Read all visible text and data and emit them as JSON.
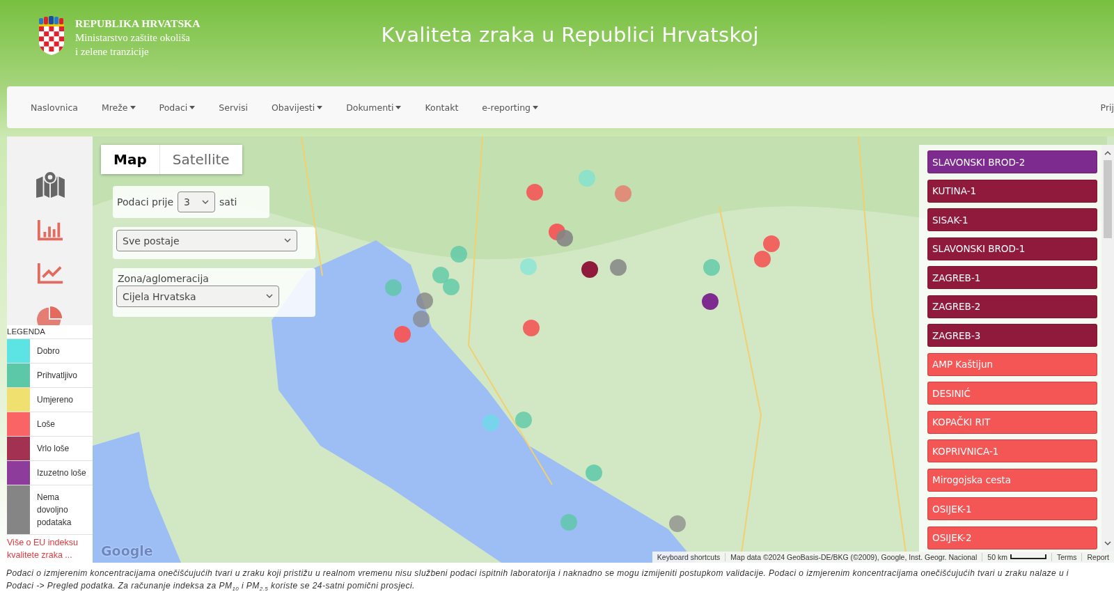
{
  "header": {
    "emblem_lines": [
      "REPUBLIKA HRVATSKA",
      "Ministarstvo zaštite okoliša",
      "i zelene tranzicije"
    ],
    "title": "Kvaliteta zraka u Republici Hrvatskoj"
  },
  "nav": {
    "items": [
      {
        "label": "Naslovnica",
        "dropdown": false
      },
      {
        "label": "Mreže",
        "dropdown": true
      },
      {
        "label": "Podaci",
        "dropdown": true
      },
      {
        "label": "Servisi",
        "dropdown": false
      },
      {
        "label": "Obavijesti",
        "dropdown": true
      },
      {
        "label": "Dokumenti",
        "dropdown": true
      },
      {
        "label": "Kontakt",
        "dropdown": false
      },
      {
        "label": "e-reporting",
        "dropdown": true
      }
    ],
    "login": "Prij"
  },
  "sidebar": {
    "tools": [
      {
        "kind": "map",
        "selected": true
      },
      {
        "kind": "bar",
        "selected": false
      },
      {
        "kind": "line",
        "selected": false
      },
      {
        "kind": "pie",
        "selected": false
      }
    ],
    "legend": {
      "title": "LEGENDA",
      "items": [
        {
          "label": "Dobro",
          "color": "#5ce4e4"
        },
        {
          "label": "Prihvatljivo",
          "color": "#5cc8a8"
        },
        {
          "label": "Umjereno",
          "color": "#f0e070"
        },
        {
          "label": "Loše",
          "color": "#fa6464"
        },
        {
          "label": "Vrlo loše",
          "color": "#a33252"
        },
        {
          "label": "Izuzetno loše",
          "color": "#8e3c9c"
        },
        {
          "label": "Nema dovoljno podataka",
          "color": "#858585"
        }
      ],
      "link": "Više o EU indeksu kvalitete zraka ..."
    }
  },
  "map": {
    "type_tabs": [
      {
        "label": "Map",
        "selected": true
      },
      {
        "label": "Satellite",
        "selected": false
      }
    ],
    "hours": {
      "prefix": "Podaci prije",
      "value": "3",
      "suffix": "sati"
    },
    "station_select": {
      "value": "Sve postaje"
    },
    "zone": {
      "label": "Zona/aglomeracija",
      "value": "Cijela Hrvatska"
    },
    "stations": [
      {
        "name": "SLAVONSKI BROD-2",
        "color": "#7e2b8f"
      },
      {
        "name": "KUTINA-1",
        "color": "#8f1a3c"
      },
      {
        "name": "SISAK-1",
        "color": "#8f1a3c"
      },
      {
        "name": "SLAVONSKI BROD-1",
        "color": "#8f1a3c"
      },
      {
        "name": "ZAGREB-1",
        "color": "#8f1a3c"
      },
      {
        "name": "ZAGREB-2",
        "color": "#8f1a3c"
      },
      {
        "name": "ZAGREB-3",
        "color": "#8f1a3c"
      },
      {
        "name": "AMP Kaštijun",
        "color": "#f45656"
      },
      {
        "name": "DESINIĆ",
        "color": "#f45656"
      },
      {
        "name": "KOPAČKI RIT",
        "color": "#f45656"
      },
      {
        "name": "KOPRIVNICA-1",
        "color": "#f45656"
      },
      {
        "name": "Mirogojska cesta",
        "color": "#f45656"
      },
      {
        "name": "OSIJEK-1",
        "color": "#f45656"
      },
      {
        "name": "OSIJEK-2",
        "color": "#f45656"
      }
    ],
    "logo": "Google",
    "attribution": {
      "shortcuts": "Keyboard shortcuts",
      "data": "Map data ©2024 GeoBasis-DE/BKG (©2009), Google, Inst. Geogr. Nacional",
      "scale": "50 km",
      "terms": "Terms",
      "report": "Report"
    }
  },
  "footer": {
    "lines": [
      "Podaci o izmjerenim koncentracijama onečišćujućih tvari u zraku koji pristižu u realnom vremenu nisu službeni podaci ispitnih laboratorija i naknadno se mogu izmijeniti postupkom validacije. Podaci o izmjerenim koncentracijama onečišćujućih tvari u zraku nalaze u i",
      "Podaci -> Pregled podatka. Za računanje indeksa za PM$_{10}$ i PM$_{2.5}$ koriste se 24-satni pomični prosjeci."
    ]
  }
}
